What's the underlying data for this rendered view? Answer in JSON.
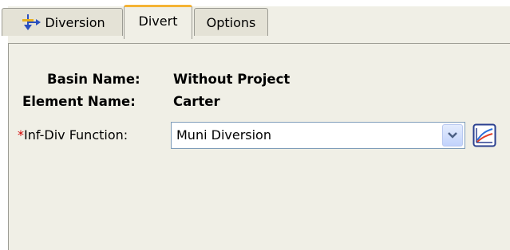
{
  "tabs": [
    {
      "label": "Diversion",
      "icon": "diversion-icon",
      "selected": false
    },
    {
      "label": "Divert",
      "selected": true
    },
    {
      "label": "Options",
      "selected": false
    }
  ],
  "form": {
    "basin_name_label": "Basin Name:",
    "basin_name_value": "Without Project",
    "element_name_label": "Element Name:",
    "element_name_value": "Carter",
    "required_marker": "*",
    "function_label": "Inf-Div Function:",
    "function_value": "Muni Diversion",
    "function_dropdown_icon": "chevron-down-icon",
    "graph_button_icon": "graph-icon"
  },
  "colors": {
    "panel_background": "#f0efe6",
    "selected_tab_accent": "#f5b335",
    "required_marker": "#d40000"
  }
}
